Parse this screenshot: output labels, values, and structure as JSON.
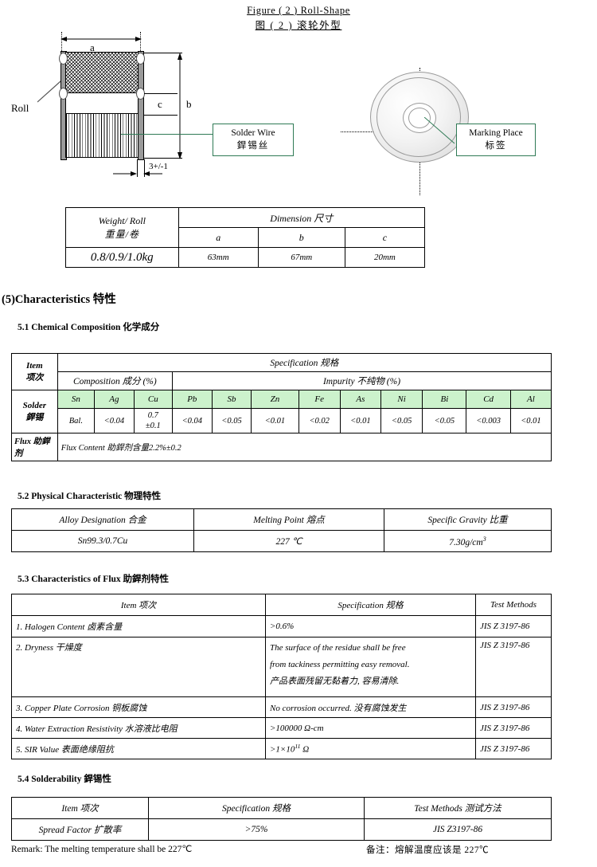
{
  "figure": {
    "title_en": "Figure ( 2 ) Roll-Shape",
    "title_cn": "图 ( 2 ) 滚轮外型",
    "roll_label": "Roll",
    "dim_a": "a",
    "dim_b": "b",
    "dim_c": "c",
    "thickness": "3+/-1",
    "callout_solder_en": "Solder Wire",
    "callout_solder_cn": "銲锡丝",
    "callout_marking_en": "Marking Place",
    "callout_marking_cn": "标签"
  },
  "weight_table": {
    "col_weight_en": "Weight/ Roll",
    "col_weight_cn": "重量/卷",
    "col_dimension": "Dimension 尺寸",
    "sub_a": "a",
    "sub_b": "b",
    "sub_c": "c",
    "weight_value": "0.8/0.9/1.0kg",
    "a_value": "63mm",
    "b_value": "67mm",
    "c_value": "20mm"
  },
  "section": {
    "main_heading": "(5)Characteristics 特性",
    "h51": "5.1 Chemical Composition  化学成分",
    "h52": "5.2 Physical Characteristic  物理特性",
    "h53": "5.3 Characteristics of Flux 助銲剂特性",
    "h54": "5.4  Solderability  銲锡性"
  },
  "chem_table": {
    "item_en": "Item",
    "item_cn": "项次",
    "specification": "Specification  规格",
    "composition": "Composition 成分 (%)",
    "impurity": "Impurity  不纯物 (%)",
    "solder_en": "Solder",
    "solder_cn": "銲锡",
    "elements": [
      "Sn",
      "Ag",
      "Cu",
      "Pb",
      "Sb",
      "Zn",
      "Fe",
      "As",
      "Ni",
      "Bi",
      "Cd",
      "Al"
    ],
    "values": [
      "Bal.",
      "<0.04",
      "0.7\n±0.1",
      "<0.04",
      "<0.05",
      "<0.01",
      "<0.02",
      "<0.01",
      "<0.05",
      "<0.05",
      "<0.003",
      "<0.01"
    ],
    "cu_value_top": "0.7",
    "cu_value_bot": "±0.1",
    "flux_label": "Flux 助銲剂",
    "flux_content": "Flux Content  助銲剂含量2.2%±0.2",
    "header_bg": "#ccf2cc"
  },
  "physical_table": {
    "col1": "Alloy Designation 合金",
    "col2": "Melting Point 熔点",
    "col3": "Specific Gravity  比重",
    "alloy": "Sn99.3/0.7Cu",
    "melting_point": "227 ℃",
    "specific_gravity_num": "7.30g/cm",
    "specific_gravity_sup": "3"
  },
  "flux_table": {
    "col_item": "Item  项次",
    "col_spec": "Specification  规格",
    "col_test": "Test Methods",
    "rows": [
      {
        "item": "1. Halogen Content  卤素含量",
        "spec": ">0.6%",
        "test": "JIS Z 3197-86"
      },
      {
        "item": "2. Dryness  干燥度",
        "spec_line1": "The surface of the residue shall be free",
        "spec_line2": "from tackiness permitting easy removal.",
        "spec_line3": "产品表面残留无黏着力, 容易清除.",
        "test": "JIS Z 3197-86"
      },
      {
        "item": "3. Copper Plate  Corrosion  铜板腐蚀",
        "spec": "No corrosion occurred.  没有腐蚀发生",
        "test": "JIS Z 3197-86"
      },
      {
        "item": "4. Water Extraction Resistivity  水溶液比电阻",
        "spec": ">100000 Ω-cm",
        "test": "JIS Z 3197-86"
      },
      {
        "item": "5. SIR Value 表面绝缘阻抗",
        "spec_pre": ">1×10",
        "spec_sup": "11",
        "spec_post": " Ω",
        "test": "JIS Z 3197-86"
      }
    ]
  },
  "solder_table": {
    "col_item": "Item  项次",
    "col_spec": "Specification  规格",
    "col_test": "Test Methods  测试方法",
    "item": "Spread Factor 扩散率",
    "spec": ">75%",
    "test": "JIS Z3197-86"
  },
  "remark": {
    "left": "Remark: The melting temperature shall be 227℃",
    "right": "备注：熔解温度应该是 227℃"
  }
}
